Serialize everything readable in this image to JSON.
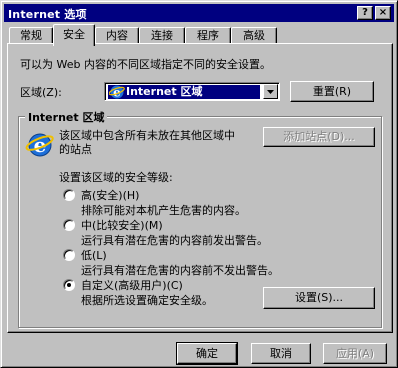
{
  "window": {
    "title": "Internet 选项",
    "help_button": "?",
    "close_button": "×"
  },
  "tabs": [
    {
      "label": "常规",
      "active": false
    },
    {
      "label": "安全",
      "active": true
    },
    {
      "label": "内容",
      "active": false
    },
    {
      "label": "连接",
      "active": false
    },
    {
      "label": "程序",
      "active": false
    },
    {
      "label": "高级",
      "active": false
    }
  ],
  "security": {
    "description": "可以为 Web 内容的不同区域指定不同的安全设置。",
    "zone_label": "区域(Z):",
    "zone_selected": "Internet 区域",
    "reset_button": "重置(R)",
    "group_title": "Internet 区域",
    "zone_description_line1": "该区域中包含所有未放在其他区域中",
    "zone_description_line2": "的站点",
    "add_sites_button": "添加站点(D)...",
    "level_prompt": "设置该区域的安全等级:",
    "levels": [
      {
        "label": "高(安全)(H)",
        "desc": "排除可能对本机产生危害的内容。",
        "selected": false
      },
      {
        "label": "中(比较安全)(M)",
        "desc": "运行具有潜在危害的内容前发出警告。",
        "selected": false
      },
      {
        "label": "低(L)",
        "desc": "运行具有潜在危害的内容前不发出警告。",
        "selected": false
      },
      {
        "label": "自定义(高级用户)(C)",
        "desc": "根据所选设置确定安全级。",
        "selected": true
      }
    ],
    "settings_button": "设置(S)..."
  },
  "footer": {
    "ok_button": "确定",
    "cancel_button": "取消",
    "apply_button": "应用(A)"
  },
  "colors": {
    "titlebar": "#000080",
    "face": "#c0c0c0",
    "highlight": "#000080"
  }
}
